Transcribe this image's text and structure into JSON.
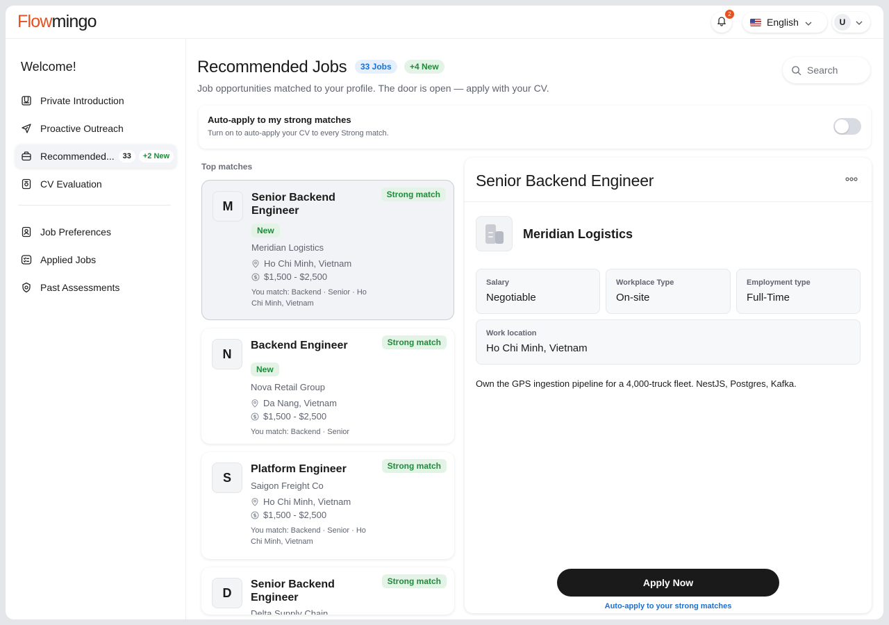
{
  "header": {
    "logo_part1": "Flow",
    "logo_part2": "mingo",
    "notification_count": "2",
    "language": "English",
    "user_initial": "U"
  },
  "sidebar": {
    "welcome": "Welcome!",
    "items": [
      {
        "label": "Private Introduction",
        "icon": "portfolio-icon"
      },
      {
        "label": "Proactive Outreach",
        "icon": "paper-plane-icon"
      },
      {
        "label": "Recommended...",
        "icon": "briefcase-icon",
        "count": "33",
        "new": "+2 New",
        "active": true
      },
      {
        "label": "CV Evaluation",
        "icon": "cv-icon"
      },
      {
        "label": "Job Preferences",
        "icon": "user-badge-icon"
      },
      {
        "label": "Applied Jobs",
        "icon": "checklist-icon"
      },
      {
        "label": "Past Assessments",
        "icon": "shield-icon"
      }
    ]
  },
  "main": {
    "title": "Recommended Jobs",
    "jobs_pill": "33 Jobs",
    "new_pill": "+4 New",
    "subtitle": "Job opportunities matched to your profile. The door is open — apply with your CV.",
    "search_placeholder": "Search",
    "auto_apply": {
      "title": "Auto-apply to my strong matches",
      "subtitle": "Turn on to auto-apply your CV to every Strong match.",
      "enabled": false
    },
    "top_matches_label": "Top matches",
    "jobs": [
      {
        "logo": "M",
        "title": "Senior Backend Engineer",
        "badge": "Strong match",
        "new": "New",
        "company": "Meridian Logistics",
        "location": "Ho Chi Minh, Vietnam",
        "salary": "$1,500 - $2,500",
        "match": "You match: Backend · Senior · Ho Chi Minh, Vietnam"
      },
      {
        "logo": "N",
        "title": "Backend Engineer",
        "badge": "Strong match",
        "new": "New",
        "company": "Nova Retail Group",
        "location": "Da Nang, Vietnam",
        "salary": "$1,500 - $2,500",
        "match": "You match: Backend · Senior"
      },
      {
        "logo": "S",
        "title": "Platform Engineer",
        "badge": "Strong match",
        "company": "Saigon Freight Co",
        "location": "Ho Chi Minh, Vietnam",
        "salary": "$1,500 - $2,500",
        "match": "You match: Backend · Senior · Ho Chi Minh, Vietnam"
      },
      {
        "logo": "D",
        "title": "Senior Backend Engineer",
        "badge": "Strong match",
        "company": "Delta Supply Chain"
      }
    ]
  },
  "detail": {
    "title": "Senior Backend Engineer",
    "company": "Meridian Logistics",
    "salary_label": "Salary",
    "salary_value": "Negotiable",
    "workplace_label": "Workplace Type",
    "workplace_value": "On-site",
    "employment_label": "Employment type",
    "employment_value": "Full-Time",
    "location_label": "Work location",
    "location_value": "Ho Chi Minh, Vietnam",
    "description": "Own the GPS ingestion pipeline for a 4,000-truck fleet. NestJS, Postgres, Kafka.",
    "apply_label": "Apply Now",
    "auto_apply_link": "Auto-apply to your strong matches"
  },
  "colors": {
    "brand": "#e8501f",
    "strong_match_text": "#1f8a3b",
    "strong_match_bg": "#e3f4e6",
    "link": "#1a6fd1",
    "primary_button": "#1a1a1a"
  }
}
